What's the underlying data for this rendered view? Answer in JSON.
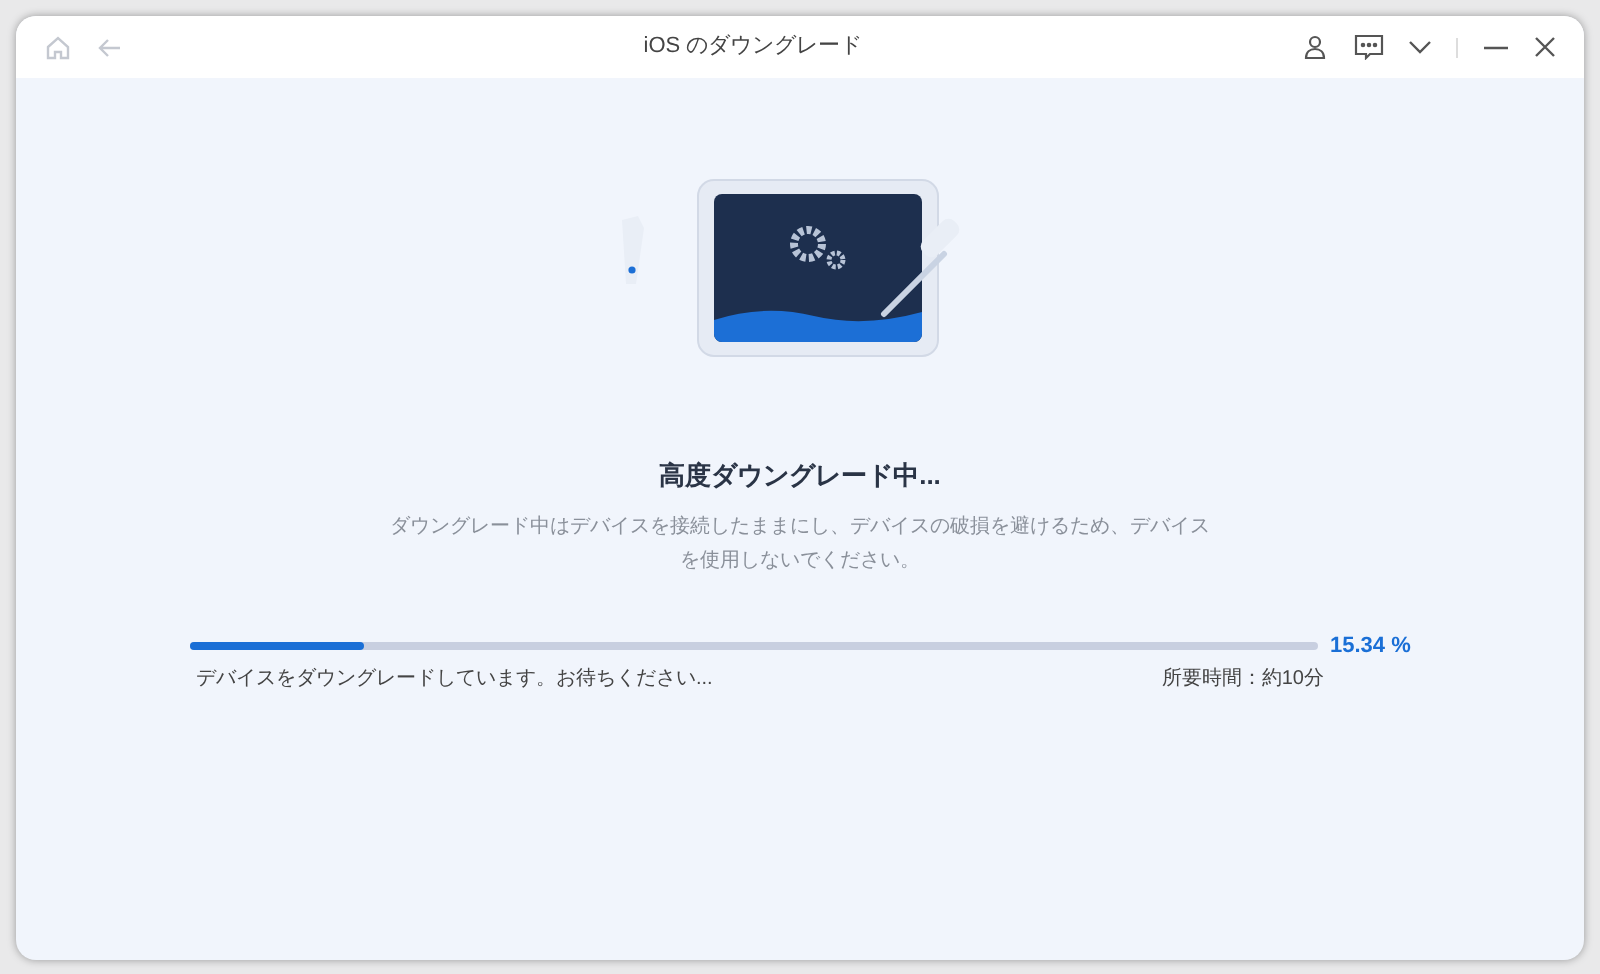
{
  "window": {
    "title": "iOS のダウングレード"
  },
  "heading": "高度ダウングレード中...",
  "description": "ダウングレード中はデバイスを接続したままにし、デバイスの破損を避けるため、デバイスを使用しないでください。",
  "progress": {
    "level": 0.1534,
    "percent": "15.34 %",
    "status": "デバイスをダウングレードしています。お待ちください...",
    "remaining": "所要時間：約10分"
  }
}
